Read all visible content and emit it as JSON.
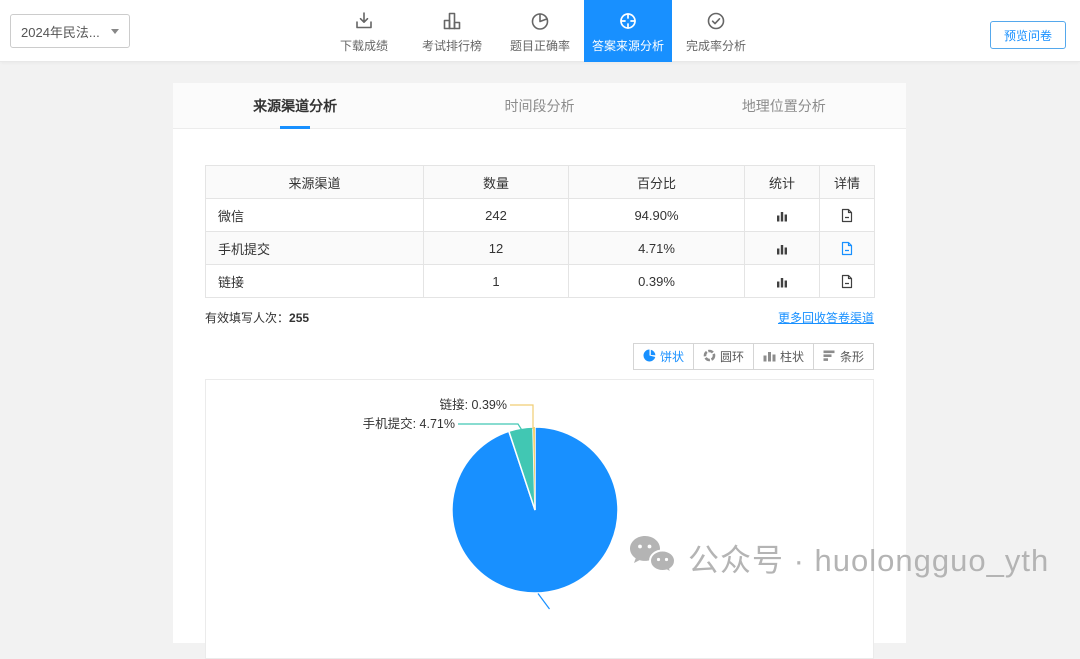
{
  "header": {
    "survey_select": {
      "value": "2024年民法..."
    },
    "nav": [
      {
        "label": "下载成绩",
        "icon": "download-icon",
        "active": false
      },
      {
        "label": "考试排行榜",
        "icon": "ranking-icon",
        "active": false
      },
      {
        "label": "题目正确率",
        "icon": "accuracy-pie-icon",
        "active": false
      },
      {
        "label": "答案来源分析",
        "icon": "source-target-icon",
        "active": true
      },
      {
        "label": "完成率分析",
        "icon": "completion-check-icon",
        "active": false
      }
    ],
    "preview_button": "预览问卷"
  },
  "tabs": [
    {
      "label": "来源渠道分析",
      "active": true
    },
    {
      "label": "时间段分析",
      "active": false
    },
    {
      "label": "地理位置分析",
      "active": false
    }
  ],
  "table": {
    "columns": [
      "来源渠道",
      "数量",
      "百分比",
      "统计",
      "详情"
    ],
    "rows": [
      {
        "channel": "微信",
        "count": "242",
        "percent": "94.90%"
      },
      {
        "channel": "手机提交",
        "count": "12",
        "percent": "4.71%"
      },
      {
        "channel": "链接",
        "count": "1",
        "percent": "0.39%"
      }
    ]
  },
  "summary": {
    "label": "有效填写人次：",
    "value": "255"
  },
  "more_link": "更多回收答卷渠道",
  "chart_toolbar": [
    {
      "label": "饼状",
      "active": true
    },
    {
      "label": "圆环",
      "active": false
    },
    {
      "label": "柱状",
      "active": false
    },
    {
      "label": "条形",
      "active": false
    }
  ],
  "chart_data": {
    "type": "pie",
    "categories": [
      "微信",
      "手机提交",
      "链接"
    ],
    "values": [
      242,
      12,
      1
    ],
    "percents": [
      "94.90%",
      "4.71%",
      "0.39%"
    ],
    "colors": [
      "#1890ff",
      "#41c7b3",
      "#f6d06e"
    ],
    "visible_labels": [
      "链接: 0.39%",
      "手机提交: 4.71%"
    ],
    "start_angle": 90,
    "clockwise": true,
    "legend_position": "none"
  },
  "watermark": {
    "text": "公众号 · huolongguo_yth"
  },
  "colors": {
    "accent": "#1890ff",
    "teal": "#41c7b3",
    "yellow": "#f6d06e",
    "page_bg": "#f2f2f2"
  }
}
